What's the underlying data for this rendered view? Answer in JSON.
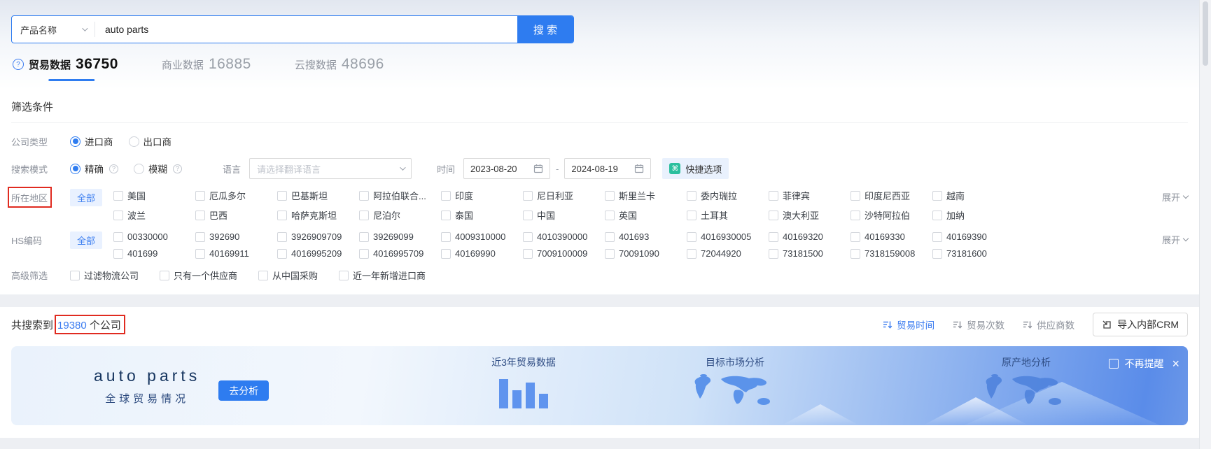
{
  "search_bar": {
    "category": "产品名称",
    "query": "auto parts",
    "search_button": "搜 索"
  },
  "tabs": [
    {
      "label": "贸易数据",
      "count": "36750",
      "active": true
    },
    {
      "label": "商业数据",
      "count": "16885",
      "active": false
    },
    {
      "label": "云搜数据",
      "count": "48696",
      "active": false
    }
  ],
  "filter": {
    "title": "筛选条件",
    "company_type": {
      "label": "公司类型",
      "options": [
        {
          "text": "进口商",
          "selected": true
        },
        {
          "text": "出口商",
          "selected": false
        }
      ]
    },
    "search_mode": {
      "label": "搜索模式",
      "options": [
        {
          "text": "精确",
          "selected": true
        },
        {
          "text": "模糊",
          "selected": false
        }
      ]
    },
    "language": {
      "label": "语言",
      "placeholder": "请选择翻译语言"
    },
    "time": {
      "label": "时间",
      "start": "2023-08-20",
      "separator": "-",
      "end": "2024-08-19"
    },
    "quick_button": "快捷选项",
    "region": {
      "label": "所在地区",
      "all": "全部",
      "expand": "展开",
      "row1": [
        "美国",
        "厄瓜多尔",
        "巴基斯坦",
        "阿拉伯联合...",
        "印度",
        "尼日利亚",
        "斯里兰卡",
        "委内瑞拉",
        "菲律宾",
        "印度尼西亚",
        "越南"
      ],
      "row2": [
        "波兰",
        "巴西",
        "哈萨克斯坦",
        "尼泊尔",
        "泰国",
        "中国",
        "英国",
        "土耳其",
        "澳大利亚",
        "沙特阿拉伯",
        "加纳"
      ]
    },
    "hscode": {
      "label": "HS编码",
      "all": "全部",
      "expand": "展开",
      "row1": [
        "00330000",
        "392690",
        "3926909709",
        "39269099",
        "4009310000",
        "4010390000",
        "401693",
        "4016930005",
        "40169320",
        "40169330",
        "40169390"
      ],
      "row2": [
        "401699",
        "40169911",
        "4016995209",
        "4016995709",
        "40169990",
        "7009100009",
        "70091090",
        "72044920",
        "73181500",
        "7318159008",
        "73181600"
      ]
    },
    "advanced": {
      "label": "高级筛选",
      "options": [
        "过滤物流公司",
        "只有一个供应商",
        "从中国采购",
        "近一年新增进口商"
      ]
    }
  },
  "results": {
    "summary_prefix": "共搜索到",
    "count": "19380",
    "summary_suffix": "个公司",
    "sorts": [
      {
        "label": "贸易时间",
        "active": true
      },
      {
        "label": "贸易次数",
        "active": false
      },
      {
        "label": "供应商数",
        "active": false
      }
    ],
    "crm_button": "导入内部CRM"
  },
  "banner": {
    "product": "auto parts",
    "subtitle": "全球贸易情况",
    "analyze_button": "去分析",
    "chart_title": "近3年贸易数据",
    "chart_bars": [
      42,
      26,
      37,
      21
    ],
    "market_title": "目标市场分析",
    "origin_title": "原产地分析",
    "dismiss_label": "不再提醒"
  },
  "colors": {
    "accent": "#2e7cf0",
    "annotation_red": "#e02b20",
    "quick_icon_green": "#2bbf9e",
    "banner_deep_blue": "#5a8ce9"
  }
}
